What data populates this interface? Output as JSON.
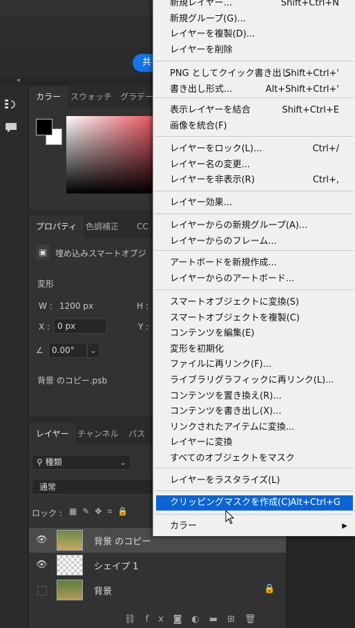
{
  "share_button": {
    "label": "共"
  },
  "collapse_arrows": "«",
  "color_panel": {
    "tabs": [
      "カラー",
      "スウォッチ",
      "グラデーシ"
    ]
  },
  "properties_panel": {
    "tabs": [
      "プロパティ",
      "色調補正",
      "CC"
    ],
    "layer_type": "埋め込みスマートオブジ",
    "transform_heading": "変形",
    "width_label": "W :",
    "width_value": "1200 px",
    "height_label": "H :",
    "x_label": "X :",
    "x_value": "0 px",
    "y_label": "Y :",
    "angle_value": "0.00°",
    "file_name": "背景 のコピー.psb"
  },
  "layers_panel": {
    "tabs": [
      "レイヤー",
      "チャンネル",
      "パス"
    ],
    "filter_label": "種類",
    "blend_mode": "通常",
    "lock_label": "ロック :",
    "layers": [
      {
        "name": "背景 のコピー",
        "visible": true,
        "selected": true
      },
      {
        "name": "シェイプ 1",
        "visible": true,
        "selected": false
      },
      {
        "name": "背景",
        "visible": false,
        "selected": false,
        "locked": true
      }
    ],
    "footer_icons": [
      "link-icon",
      "fx-icon",
      "mask-icon",
      "adjustment-icon",
      "folder-icon",
      "new-layer-icon",
      "trash-icon"
    ],
    "fx_label": "fx"
  },
  "context_menu": {
    "groups": [
      [
        {
          "label": "新規レイヤー...",
          "shortcut": "Shift+Ctrl+N"
        },
        {
          "label": "新規グループ(G)...",
          "shortcut": ""
        },
        {
          "label": "レイヤーを複製(D)...",
          "shortcut": ""
        },
        {
          "label": "レイヤーを削除",
          "shortcut": ""
        }
      ],
      [
        {
          "label": "PNG としてクイック書き出し",
          "shortcut": "Shift+Ctrl+'"
        },
        {
          "label": "書き出し形式...",
          "shortcut": "Alt+Shift+Ctrl+'"
        }
      ],
      [
        {
          "label": "表示レイヤーを結合",
          "shortcut": "Shift+Ctrl+E"
        },
        {
          "label": "画像を統合(F)",
          "shortcut": ""
        }
      ],
      [
        {
          "label": "レイヤーをロック(L)...",
          "shortcut": "Ctrl+/"
        },
        {
          "label": "レイヤー名の変更...",
          "shortcut": ""
        },
        {
          "label": "レイヤーを非表示(R)",
          "shortcut": "Ctrl+,"
        }
      ],
      [
        {
          "label": "レイヤー効果...",
          "shortcut": ""
        }
      ],
      [
        {
          "label": "レイヤーからの新規グループ(A)...",
          "shortcut": ""
        },
        {
          "label": "レイヤーからのフレーム...",
          "shortcut": ""
        }
      ],
      [
        {
          "label": "アートボードを新規作成...",
          "shortcut": ""
        },
        {
          "label": "レイヤーからのアートボード...",
          "shortcut": ""
        }
      ],
      [
        {
          "label": "スマートオブジェクトに変換(S)",
          "shortcut": ""
        },
        {
          "label": "スマートオブジェクトを複製(C)",
          "shortcut": ""
        },
        {
          "label": "コンテンツを編集(E)",
          "shortcut": ""
        },
        {
          "label": "変形を初期化",
          "shortcut": ""
        },
        {
          "label": "ファイルに再リンク(F)...",
          "shortcut": ""
        },
        {
          "label": "ライブラリグラフィックに再リンク(L)...",
          "shortcut": ""
        },
        {
          "label": "コンテンツを置き換え(R)...",
          "shortcut": ""
        },
        {
          "label": "コンテンツを書き出し(X)...",
          "shortcut": ""
        },
        {
          "label": "リンクされたアイテムに変換...",
          "shortcut": ""
        },
        {
          "label": "レイヤーに変換",
          "shortcut": ""
        },
        {
          "label": "すべてのオブジェクトをマスク",
          "shortcut": ""
        }
      ],
      [
        {
          "label": "レイヤーをラスタライズ(L)",
          "shortcut": ""
        }
      ],
      [
        {
          "label": "クリッピングマスクを作成(C)",
          "shortcut": "Alt+Ctrl+G",
          "highlighted": true
        }
      ],
      [
        {
          "label": "カラー",
          "shortcut": "",
          "submenu": true
        }
      ]
    ]
  }
}
